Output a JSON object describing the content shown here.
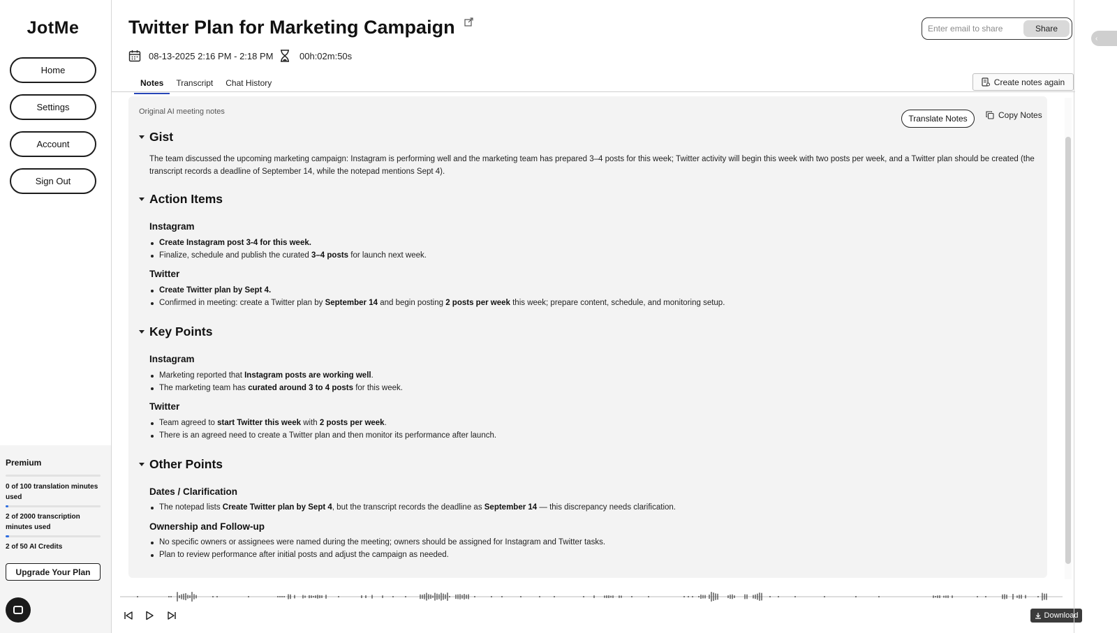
{
  "sidebar": {
    "logo": "JotMe",
    "nav": [
      {
        "label": "Home"
      },
      {
        "label": "Settings"
      },
      {
        "label": "Account"
      },
      {
        "label": "Sign Out"
      }
    ],
    "plan": {
      "name": "Premium",
      "usage": [
        {
          "text": "0 of 100 translation minutes used",
          "fraction": 0.0
        },
        {
          "text": "2 of 2000 transcription minutes used",
          "fraction": 0.001
        },
        {
          "text": "2 of 50 AI Credits",
          "fraction": 0.04
        }
      ],
      "upgrade_label": "Upgrade Your Plan"
    }
  },
  "header": {
    "title": "Twitter Plan for Marketing Campaign",
    "datetime": "08-13-2025 2:16 PM - 2:18 PM",
    "duration": "00h:02m:50s",
    "share_placeholder": "Enter email to share",
    "share_label": "Share",
    "tabs": [
      {
        "label": "Notes",
        "active": true
      },
      {
        "label": "Transcript",
        "active": false
      },
      {
        "label": "Chat History",
        "active": false
      }
    ],
    "create_again_label": "Create notes again"
  },
  "notes": {
    "label": "Original AI meeting notes",
    "translate_label": "Translate Notes",
    "copy_label": "Copy Notes",
    "gist": {
      "heading": "Gist",
      "text": "The team discussed the upcoming marketing campaign: Instagram is performing well and the marketing team has prepared 3–4 posts for this week; Twitter activity will begin this week with two posts per week, and a Twitter plan should be created (the transcript records a deadline of September 14, while the notepad mentions Sept 4)."
    },
    "action_items": {
      "heading": "Action Items",
      "instagram": {
        "heading": "Instagram",
        "b1": "Create Instagram post 3-4 for this week.",
        "b2_pre": "Finalize, schedule and publish the curated ",
        "b2_bold": "3–4 posts",
        "b2_post": " for launch next week."
      },
      "twitter": {
        "heading": "Twitter",
        "b1": "Create Twitter plan by Sept 4.",
        "b2_pre": "Confirmed in meeting: create a Twitter plan by ",
        "b2_bold1": "September 14",
        "b2_mid": " and begin posting ",
        "b2_bold2": "2 posts per week",
        "b2_post": " this week; prepare content, schedule, and monitoring setup."
      }
    },
    "key_points": {
      "heading": "Key Points",
      "instagram": {
        "heading": "Instagram",
        "b1_pre": "Marketing reported that ",
        "b1_bold": "Instagram posts are working well",
        "b1_post": ".",
        "b2_pre": "The marketing team has ",
        "b2_bold": "curated around 3 to 4 posts",
        "b2_post": " for this week."
      },
      "twitter": {
        "heading": "Twitter",
        "b1_pre": "Team agreed to ",
        "b1_bold1": "start Twitter this week",
        "b1_mid": " with ",
        "b1_bold2": "2 posts per week",
        "b1_post": ".",
        "b2": "There is an agreed need to create a Twitter plan and then monitor its performance after launch."
      }
    },
    "other_points": {
      "heading": "Other Points",
      "dates": {
        "heading": "Dates / Clarification",
        "b1_pre": "The notepad lists ",
        "b1_bold1": "Create Twitter plan by Sept 4",
        "b1_mid": ", but the transcript records the deadline as ",
        "b1_bold2": "September 14",
        "b1_post": " — this discrepancy needs clarification."
      },
      "ownership": {
        "heading": "Ownership and Follow-up",
        "b1": "No specific owners or assignees were named during the meeting; owners should be assigned for Instagram and Twitter tasks.",
        "b2": "Plan to review performance after initial posts and adjust the campaign as needed."
      }
    }
  },
  "player": {
    "download_label": "Download"
  },
  "colors": {
    "accent": "#2746b8",
    "progress": "#2d6cdf",
    "panel_bg": "#f3f3f3"
  }
}
